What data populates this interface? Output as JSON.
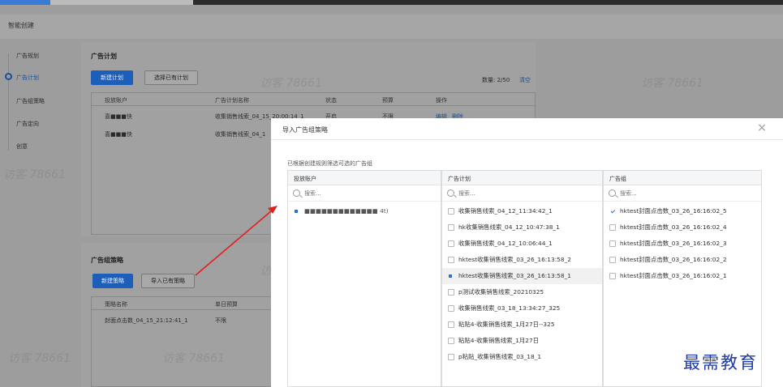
{
  "page": {
    "breadcrumb": "智能创建"
  },
  "sidebar": {
    "items": [
      {
        "label": "广告规划"
      },
      {
        "label": "广告计划"
      },
      {
        "label": "广告组策略"
      },
      {
        "label": "广告定向"
      },
      {
        "label": "创意"
      }
    ]
  },
  "plan_panel": {
    "title": "广告计划",
    "new_button": "新建计划",
    "choose_button": "选择已有计划",
    "count_label": "数量: 2/50",
    "clear_link": "清空",
    "columns": [
      "投放账户",
      "广告计划名称",
      "状态",
      "预算",
      "操作"
    ],
    "rows": [
      {
        "account": "喜■■■快",
        "name": "收集销售线索_04_15_20:00:14_1",
        "status": "开启",
        "budget": "不限",
        "action_edit": "编辑",
        "action_delete": "删除"
      },
      {
        "account": "喜■■■快",
        "name": "收集销售线索_04_1"
      }
    ]
  },
  "group_panel": {
    "title": "广告组策略",
    "new_button": "新建策略",
    "import_button": "导入已有策略",
    "columns": [
      "策略名称",
      "单日预算"
    ],
    "rows": [
      {
        "name": "封面点击数_04_15_21:12:41_1",
        "budget": "不限"
      }
    ]
  },
  "watermark": {
    "text": "访客 78661"
  },
  "modal": {
    "title": "导入广告组策略",
    "hint": "已根据创建规则筛选可选的广告组",
    "search_placeholder": "搜索...",
    "accounts": {
      "header": "投放账户",
      "items": [
        {
          "label": "■■■■■■■■■■■■■ 4t)",
          "selected": true
        }
      ]
    },
    "plans": {
      "header": "广告计划",
      "items": [
        {
          "label": "收集销售线索_04_12_11:34:42_1",
          "checked": false
        },
        {
          "label": "hk收集销售线索_04_12_10:47:38_1",
          "checked": false
        },
        {
          "label": "收集销售线索_04_12_10:06:44_1",
          "checked": false
        },
        {
          "label": "hktest收集销售线索_03_26_16:13:58_2",
          "checked": false
        },
        {
          "label": "hktest收集销售线索_03_26_16:13:58_1",
          "checked": false,
          "selected": true
        },
        {
          "label": "p测试收集销售线索_20210325",
          "checked": false
        },
        {
          "label": "收集销售线索_03_18_13:34:27_325",
          "checked": false
        },
        {
          "label": "粘贴4-收集销售线索_1月27日--325",
          "checked": false
        },
        {
          "label": "粘贴4-收集销售线索_1月27日",
          "checked": false
        },
        {
          "label": "p粘贴_收集销售线索_03_18_1",
          "checked": false
        }
      ]
    },
    "groups": {
      "header": "广告组",
      "items": [
        {
          "label": "hktest封面点击数_03_26_16:16:02_5",
          "checked": true
        },
        {
          "label": "hktest封面点击数_03_26_16:16:02_4",
          "checked": false
        },
        {
          "label": "hktest封面点击数_03_26_16:16:02_3",
          "checked": false
        },
        {
          "label": "hktest封面点击数_03_26_16:16:02_2",
          "checked": false
        },
        {
          "label": "hktest封面点击数_03_26_16:16:02_1",
          "checked": false
        }
      ]
    }
  },
  "brand": {
    "text": "最需教育"
  },
  "colors": {
    "primary": "#1d5fb8",
    "annotation_arrow": "#e02020",
    "brand_text": "#1d3aa8"
  }
}
